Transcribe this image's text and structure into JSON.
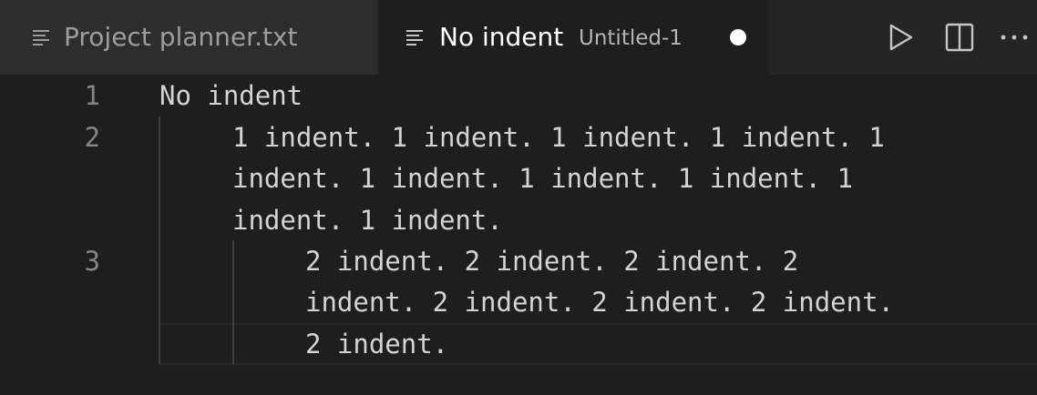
{
  "tabs": [
    {
      "label": "Project planner.txt",
      "icon": "file-text-icon",
      "active": false
    },
    {
      "label": "No indent",
      "description": "Untitled-1",
      "icon": "file-text-icon",
      "active": true,
      "dirty": true
    }
  ],
  "actions": [
    {
      "name": "run-icon"
    },
    {
      "name": "split-editor-icon"
    },
    {
      "name": "more-actions-icon",
      "glyph": "···"
    }
  ],
  "editor": {
    "line_numbers": [
      "1",
      "2",
      "3"
    ],
    "visual_lines": [
      "No indent",
      "1 indent. 1 indent. 1 indent. 1 indent. 1",
      "indent. 1 indent. 1 indent. 1 indent. 1",
      "indent. 1 indent.",
      "2 indent. 2 indent. 2 indent. 2",
      "indent. 2 indent. 2 indent. 2 indent.",
      "2 indent."
    ]
  },
  "colors": {
    "background": "#1e1e1e",
    "tabbar": "#252526",
    "inactive_tab": "#2d2d2d",
    "text": "#d4d4d4",
    "line_number": "#858585"
  }
}
